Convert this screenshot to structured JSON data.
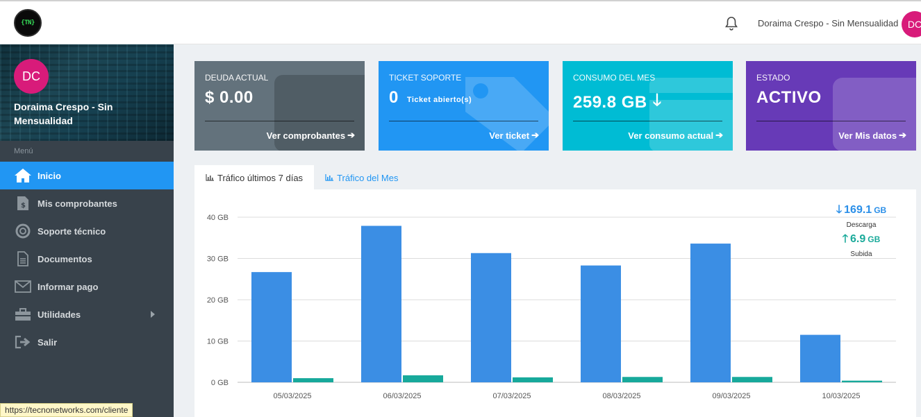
{
  "header": {
    "logo_text": "{TN}",
    "user_name": "Doraima Crespo - Sin Mensualidad",
    "avatar_initials": "DC"
  },
  "sidebar": {
    "avatar_initials": "DC",
    "user_name": "Doraima Crespo - Sin Mensualidad",
    "menu_title": "Menú",
    "items": [
      {
        "label": "Inicio",
        "icon": "home-icon",
        "active": true
      },
      {
        "label": "Mis comprobantes",
        "icon": "invoice-icon"
      },
      {
        "label": "Soporte técnico",
        "icon": "lifebuoy-icon"
      },
      {
        "label": "Documentos",
        "icon": "document-icon"
      },
      {
        "label": "Informar pago",
        "icon": "envelope-icon"
      },
      {
        "label": "Utilidades",
        "icon": "toolbox-icon",
        "has_submenu": true
      },
      {
        "label": "Salir",
        "icon": "sign-out-icon"
      }
    ]
  },
  "cards": [
    {
      "label": "DEUDA ACTUAL",
      "value": "$ 0.00",
      "link": "Ver comprobantes",
      "color": "#63727c"
    },
    {
      "label": "TICKET SOPORTE",
      "value": "0",
      "value_suffix": "Ticket abierto(s)",
      "link": "Ver ticket",
      "color": "#2196f3"
    },
    {
      "label": "CONSUMO DEL MES",
      "value": "259.8 GB",
      "link": "Ver consumo actual",
      "color": "#00bcd4"
    },
    {
      "label": "ESTADO",
      "value": "ACTIVO",
      "link": "Ver Mis datos",
      "color": "#673ab7"
    }
  ],
  "tabs": [
    {
      "label": "Tráfico últimos 7 días",
      "active": true
    },
    {
      "label": "Tráfico del Mes",
      "active": false
    }
  ],
  "totals": {
    "download_value": "169.1",
    "download_unit": "GB",
    "download_label": "Descarga",
    "upload_value": "6.9",
    "upload_unit": "GB",
    "upload_label": "Subida"
  },
  "chart_data": {
    "type": "bar",
    "categories": [
      "05/03/2025",
      "06/03/2025",
      "07/03/2025",
      "08/03/2025",
      "09/03/2025",
      "10/03/2025"
    ],
    "series": [
      {
        "name": "Descarga",
        "color": "#3b8ee4",
        "values": [
          26.7,
          37.9,
          31.3,
          28.3,
          33.6,
          11.5
        ]
      },
      {
        "name": "Subida",
        "color": "#17a99b",
        "values": [
          1.0,
          1.7,
          1.2,
          1.3,
          1.3,
          0.4
        ]
      }
    ],
    "yticks": [
      "0 GB",
      "10 GB",
      "20 GB",
      "30 GB",
      "40 GB"
    ],
    "ylim": [
      0,
      40
    ],
    "grid": true
  },
  "status_bar": {
    "url": "https://tecnonetworks.com/cliente"
  }
}
